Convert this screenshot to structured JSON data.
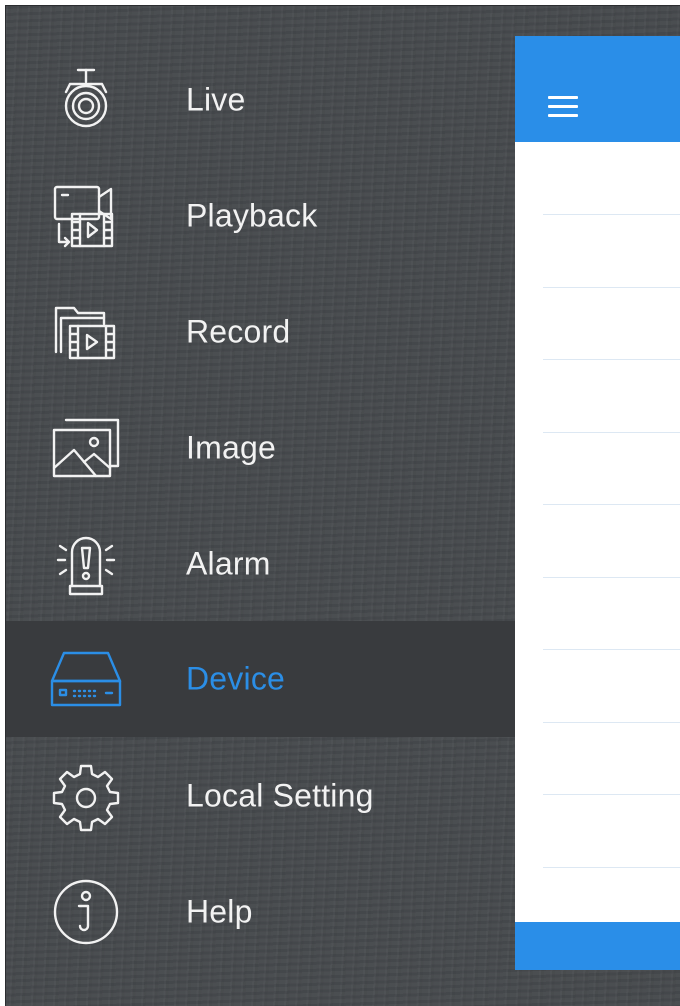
{
  "menu": {
    "items": [
      {
        "label": "Live",
        "icon": "camera-icon",
        "active": false
      },
      {
        "label": "Playback",
        "icon": "playback-icon",
        "active": false
      },
      {
        "label": "Record",
        "icon": "record-folder-icon",
        "active": false
      },
      {
        "label": "Image",
        "icon": "image-icon",
        "active": false
      },
      {
        "label": "Alarm",
        "icon": "alarm-icon",
        "active": false
      },
      {
        "label": "Device",
        "icon": "device-dvr-icon",
        "active": true
      },
      {
        "label": "Local Setting",
        "icon": "gear-icon",
        "active": false
      },
      {
        "label": "Help",
        "icon": "info-icon",
        "active": false
      }
    ]
  },
  "panel": {
    "menu_button_icon": "hamburger-menu-icon"
  },
  "colors": {
    "sidebar_background": "#474a4e",
    "active_row_background": "#393b3e",
    "active_text": "#2b8ee6",
    "header_blue": "#2a8ee8",
    "menu_text": "#f2f2f2"
  }
}
